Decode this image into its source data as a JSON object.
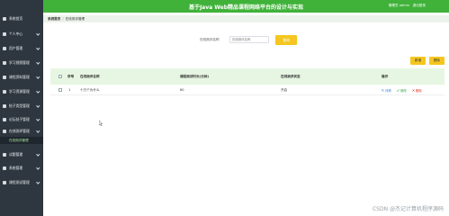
{
  "sidebar": {
    "items": [
      {
        "label": "系统首页",
        "icon": "home-icon"
      },
      {
        "label": "个人中心",
        "icon": "user-icon"
      },
      {
        "label": "用户管理",
        "icon": "users-icon"
      },
      {
        "label": "学习视频管理",
        "icon": "video-icon"
      },
      {
        "label": "课程资料管理",
        "icon": "book-icon"
      },
      {
        "label": "学习资源管理",
        "icon": "folder-icon"
      },
      {
        "label": "帖子类型管理",
        "icon": "tag-icon"
      },
      {
        "label": "论坛帖子管理",
        "icon": "forum-icon"
      },
      {
        "label": "在线测评管理",
        "icon": "exam-icon"
      },
      {
        "label": "试题管理",
        "icon": "question-icon"
      },
      {
        "label": "系统管理",
        "icon": "settings-icon"
      },
      {
        "label": "课程测试管理",
        "icon": "test-icon"
      }
    ],
    "active_sub": "在线测评管理"
  },
  "header": {
    "title": "基于Java Web精品课程网络平台的设计与实现",
    "user": "管理员 admin",
    "logout": "退出登录"
  },
  "breadcrumb": {
    "home": "系统首页",
    "current": "在线测评管理"
  },
  "search": {
    "label": "在线测评名称",
    "placeholder": "在线测评名称",
    "button": "查询"
  },
  "toolbar": {
    "add": "新增",
    "delete": "删除"
  },
  "table": {
    "index_header": "序号",
    "columns": [
      "在线测评名称",
      "课程测试时长(分钟)",
      "在线测评状态",
      "操作"
    ],
    "rows": [
      {
        "index": "1",
        "name": "十万个为什么",
        "duration": "60",
        "status": "开启"
      }
    ],
    "actions": {
      "detail": "详情",
      "edit": "修改",
      "remove": "删除"
    }
  },
  "watermark": "CSDN @杰记计算机程序源码",
  "colors": {
    "header_green": "#40b23a",
    "sidebar": "#2e3740",
    "button_yellow": "#f5c61f",
    "table_header": "#e7f6e2"
  }
}
